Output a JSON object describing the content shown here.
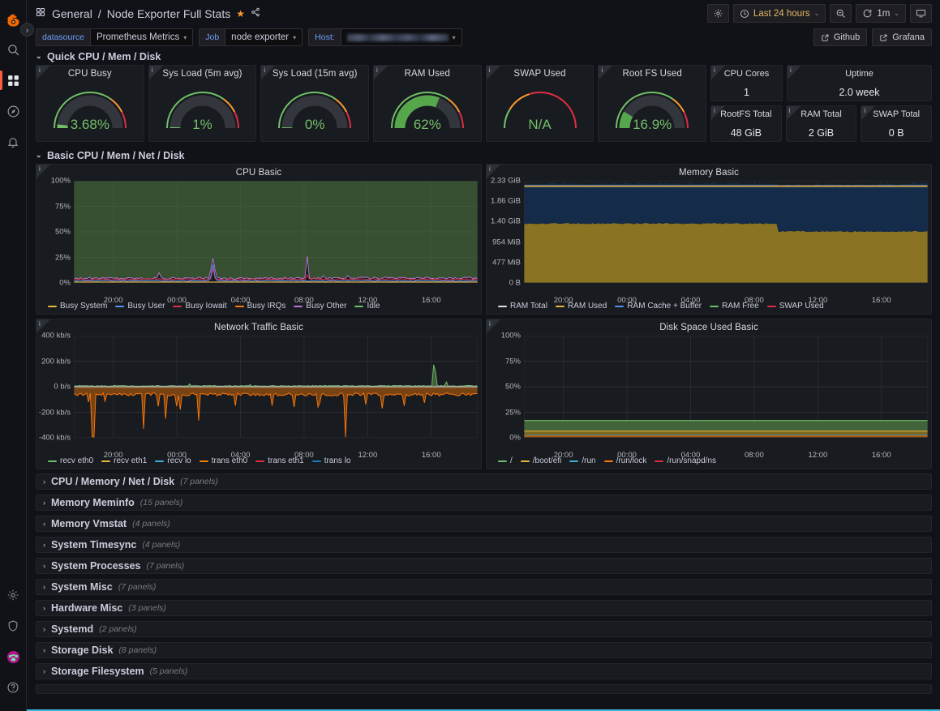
{
  "app": {
    "brand_icon": "grafana-logo-icon",
    "sidebar_items": [
      {
        "name": "search",
        "icon": "search-icon"
      },
      {
        "name": "dashboards",
        "icon": "dashboards-grid-icon",
        "active": true
      },
      {
        "name": "explore",
        "icon": "compass-icon"
      },
      {
        "name": "alerting",
        "icon": "bell-icon"
      }
    ],
    "sidebar_bottom_items": [
      {
        "name": "configuration",
        "icon": "gear-icon"
      },
      {
        "name": "server-admin",
        "icon": "shield-icon"
      },
      {
        "name": "profile",
        "icon": "avatar-icon"
      },
      {
        "name": "help",
        "icon": "question-circle-icon"
      }
    ],
    "sidebar_toggle": "›"
  },
  "header": {
    "folder": "General",
    "separator": "/",
    "dashboard_title": "Node Exporter Full Stats",
    "star_glyph": "★",
    "share_icon": "share-icon",
    "grid_icon": "dashboard-grid-icon",
    "settings_icon": "gear-icon",
    "time_picker": {
      "icon": "clock-icon",
      "label": "Last 24 hours",
      "caret": "⌄"
    },
    "zoom_out_icon": "zoom-out-icon",
    "refresh_icon": "refresh-icon",
    "refresh_interval": "1m",
    "refresh_caret": "⌄",
    "tv_icon": "tv-mode-icon"
  },
  "variables": [
    {
      "label": "datasource",
      "value": "Prometheus Metrics",
      "redacted": false
    },
    {
      "label": "Job",
      "value": "node exporter",
      "redacted": false
    },
    {
      "label": "Host:",
      "value": "",
      "redacted": true
    }
  ],
  "links": [
    {
      "label": "Github",
      "icon": "external-link-icon"
    },
    {
      "label": "Grafana",
      "icon": "external-link-icon"
    }
  ],
  "rows": {
    "quick": {
      "title": "Quick CPU / Mem / Disk",
      "chevron": "⌄",
      "expanded": true
    },
    "basic": {
      "title": "Basic CPU / Mem / Net / Disk",
      "chevron": "⌄",
      "expanded": true
    }
  },
  "gauges": [
    {
      "title": "CPU Busy",
      "value": "3.68%",
      "pct": 3.68,
      "color": "#73bf69"
    },
    {
      "title": "Sys Load (5m avg)",
      "value": "1%",
      "pct": 1,
      "color": "#73bf69"
    },
    {
      "title": "Sys Load (15m avg)",
      "value": "0%",
      "pct": 0,
      "color": "#73bf69"
    },
    {
      "title": "RAM Used",
      "value": "62%",
      "pct": 62,
      "color": "#56a64b"
    },
    {
      "title": "SWAP Used",
      "value": "N/A",
      "pct": 0,
      "color": "#73bf69",
      "no_data": true
    },
    {
      "title": "Root FS Used",
      "value": "16.9%",
      "pct": 16.9,
      "color": "#56a64b"
    }
  ],
  "stats": [
    {
      "title": "CPU Cores",
      "value": "1"
    },
    {
      "title": "Uptime",
      "value": "2.0 week"
    },
    {
      "title": "RootFS Total",
      "value": "48 GiB"
    },
    {
      "title": "RAM Total",
      "value": "2 GiB"
    },
    {
      "title": "SWAP Total",
      "value": "0 B"
    }
  ],
  "chart_data": [
    {
      "type": "area",
      "title": "CPU Basic",
      "ylabel": "",
      "xlabel": "",
      "yticks": [
        "100%",
        "75%",
        "50%",
        "25%",
        "0%"
      ],
      "ylim": [
        0,
        100
      ],
      "xticks": [
        "20:00",
        "00:00",
        "04:00",
        "08:00",
        "12:00",
        "16:00"
      ],
      "grid": true,
      "legend_position": "bottom",
      "series": [
        {
          "name": "Busy System",
          "color": "#eab839",
          "mean": 1.2
        },
        {
          "name": "Busy User",
          "color": "#5794f2",
          "mean": 2.5
        },
        {
          "name": "Busy Iowait",
          "color": "#e02f44",
          "mean": 0.4
        },
        {
          "name": "Busy IRQs",
          "color": "#ff780a",
          "mean": 0.1
        },
        {
          "name": "Busy Other",
          "color": "#b877d9",
          "mean": 4.0
        },
        {
          "name": "Idle",
          "color": "#73bf69",
          "mean": 96.0
        }
      ]
    },
    {
      "type": "area",
      "title": "Memory Basic",
      "ylabel": "",
      "xlabel": "",
      "yticks": [
        "2.33 GiB",
        "1.86 GiB",
        "1.40 GiB",
        "954 MiB",
        "477 MiB",
        "0 B"
      ],
      "ylim": [
        0,
        2.33
      ],
      "xticks": [
        "20:00",
        "00:00",
        "04:00",
        "08:00",
        "12:00",
        "16:00"
      ],
      "grid": true,
      "legend_position": "bottom",
      "series": [
        {
          "name": "RAM Total",
          "color": "#dedede",
          "value_gib": 1.88
        },
        {
          "name": "RAM Used",
          "color": "#eab839",
          "value_gib": 1.17
        },
        {
          "name": "RAM Cache + Buffer",
          "color": "#5794f2",
          "value_gib": 0.68
        },
        {
          "name": "RAM Free",
          "color": "#73bf69",
          "value_gib": 0.03
        },
        {
          "name": "SWAP Used",
          "color": "#e02f44",
          "value_gib": 0
        }
      ]
    },
    {
      "type": "area",
      "title": "Network Traffic Basic",
      "ylabel": "",
      "xlabel": "",
      "yticks": [
        "400 kb/s",
        "200 kb/s",
        "0 b/s",
        "-200 kb/s",
        "-400 kb/s"
      ],
      "ylim": [
        -400,
        400
      ],
      "xticks": [
        "20:00",
        "00:00",
        "04:00",
        "08:00",
        "12:00",
        "16:00"
      ],
      "grid": true,
      "legend_position": "bottom",
      "series": [
        {
          "name": "recv eth0",
          "color": "#73bf69",
          "mean": 12
        },
        {
          "name": "recv eth1",
          "color": "#eab839",
          "mean": 0
        },
        {
          "name": "recv lo",
          "color": "#3db3d6",
          "mean": 0
        },
        {
          "name": "trans eth0",
          "color": "#ff780a",
          "mean": -58
        },
        {
          "name": "trans eth1",
          "color": "#e02f44",
          "mean": 0
        },
        {
          "name": "trans lo",
          "color": "#1f78c1",
          "mean": 0
        }
      ]
    },
    {
      "type": "area",
      "title": "Disk Space Used Basic",
      "ylabel": "",
      "xlabel": "",
      "yticks": [
        "100%",
        "75%",
        "50%",
        "25%",
        "0%"
      ],
      "ylim": [
        0,
        100
      ],
      "xticks": [
        "20:00",
        "00:00",
        "04:00",
        "08:00",
        "12:00",
        "16:00"
      ],
      "grid": true,
      "legend_position": "bottom",
      "series": [
        {
          "name": "/",
          "color": "#73bf69",
          "value": 16.9
        },
        {
          "name": "/boot/efi",
          "color": "#eab839",
          "value": 5.5
        },
        {
          "name": "/run",
          "color": "#3db3d6",
          "value": 2.0
        },
        {
          "name": "/run/lock",
          "color": "#ff780a",
          "value": 1.0
        },
        {
          "name": "/run/snapd/ns",
          "color": "#e02f44",
          "value": 0.5
        }
      ]
    }
  ],
  "collapsed_rows": [
    {
      "title": "CPU / Memory / Net / Disk",
      "panels": "(7 panels)"
    },
    {
      "title": "Memory Meminfo",
      "panels": "(15 panels)"
    },
    {
      "title": "Memory Vmstat",
      "panels": "(4 panels)"
    },
    {
      "title": "System Timesync",
      "panels": "(4 panels)"
    },
    {
      "title": "System Processes",
      "panels": "(7 panels)"
    },
    {
      "title": "System Misc",
      "panels": "(7 panels)"
    },
    {
      "title": "Hardware Misc",
      "panels": "(3 panels)"
    },
    {
      "title": "Systemd",
      "panels": "(2 panels)"
    },
    {
      "title": "Storage Disk",
      "panels": "(8 panels)"
    },
    {
      "title": "Storage Filesystem",
      "panels": "(5 panels)"
    },
    {
      "title": "",
      "panels": ""
    }
  ],
  "colors": {
    "accent": "#f55f3e",
    "panel_bg": "#181b1f",
    "page_bg": "#111217",
    "green": "#73bf69",
    "orange": "#ff780a",
    "red": "#e02f44"
  }
}
